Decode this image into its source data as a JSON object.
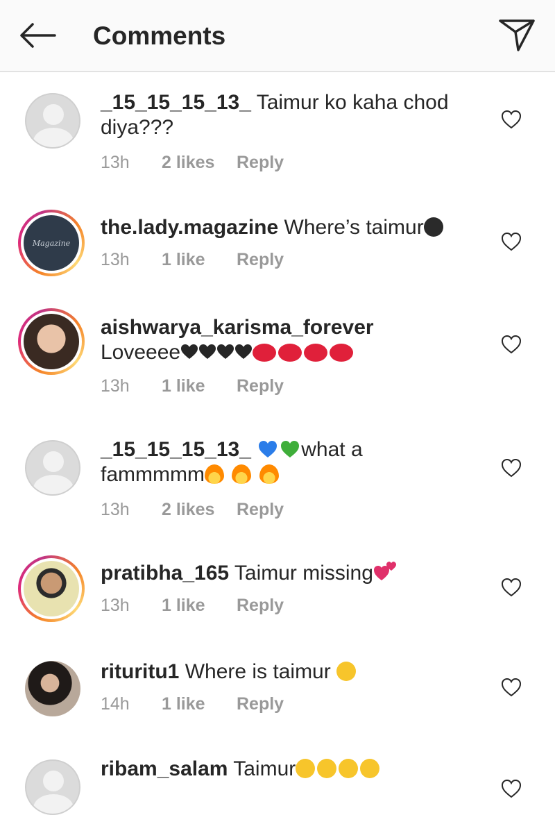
{
  "header": {
    "title": "Comments"
  },
  "comments": [
    {
      "username": "_15_15_15_13_",
      "text": "Taimur ko kaha chod diya???",
      "time": "13h",
      "likes": "2 likes",
      "reply": "Reply"
    },
    {
      "username": "the.lady.magazine",
      "text": "Where’s taimur",
      "time": "13h",
      "likes": "1 like",
      "reply": "Reply",
      "avatar_text": "Magazine"
    },
    {
      "username": "aishwarya_karisma_forever",
      "text": "Loveeee",
      "time": "13h",
      "likes": "1 like",
      "reply": "Reply"
    },
    {
      "username": "_15_15_15_13_",
      "text_after_emoji": "what a",
      "text_line2": "fammmmm",
      "time": "13h",
      "likes": "2 likes",
      "reply": "Reply"
    },
    {
      "username": "pratibha_165",
      "text": "Taimur missing",
      "time": "13h",
      "likes": "1 like",
      "reply": "Reply"
    },
    {
      "username": "rituritu1",
      "text": "Where is taimur",
      "time": "14h",
      "likes": "1 like",
      "reply": "Reply"
    },
    {
      "username": "ribam_salam",
      "text": "Taimur"
    }
  ],
  "icons": {
    "back": "arrow-left-icon",
    "send": "paper-plane-icon",
    "like": "heart-outline-icon"
  },
  "colors": {
    "meta_text": "#999999",
    "story_ring": "#dd2a7b",
    "text": "#262626"
  }
}
